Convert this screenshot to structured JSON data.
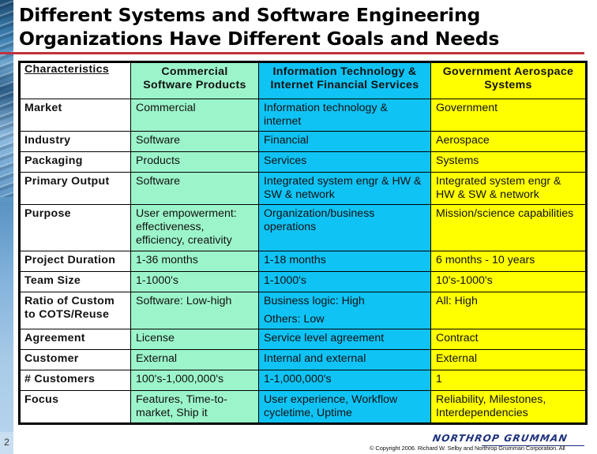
{
  "slide": {
    "title_line1": "Different Systems and Software Engineering",
    "title_line2": "Organizations Have Different Goals and Needs",
    "page_number": "2",
    "logo_text": "NORTHROP GRUMMAN",
    "copyright": "© Copyright 2006. Richard W. Selby and Northrop Grumman Corporation. All"
  },
  "colors": {
    "commercial": "#9cf5ca",
    "it_financial": "#10c3f5",
    "government": "#ffff00",
    "title_rule": "#c0303c"
  },
  "table": {
    "headers": [
      "Characteristics",
      "Commercial Software Products",
      "Information Technology & Internet Financial Services",
      "Government Aerospace Systems"
    ],
    "header_lines": {
      "commercial": [
        "Commercial",
        "Software Products"
      ],
      "it": [
        "Information Technology &",
        "Internet Financial Services"
      ],
      "gov": [
        "Government Aerospace",
        "Systems"
      ]
    },
    "rows": [
      {
        "label": "Market",
        "commercial": "Commercial",
        "it": "Information technology & internet",
        "gov": "Government"
      },
      {
        "label": "Industry",
        "commercial": "Software",
        "it": "Financial",
        "gov": "Aerospace"
      },
      {
        "label": "Packaging",
        "commercial": "Products",
        "it": "Services",
        "gov": "Systems"
      },
      {
        "label": "Primary Output",
        "commercial": "Software",
        "it": "Integrated system engr & HW & SW & network",
        "gov": "Integrated system engr & HW & SW & network"
      },
      {
        "label": "Purpose",
        "commercial": "User empowerment: effectiveness, efficiency, creativity",
        "it": "Organization/business operations",
        "gov": "Mission/science capabilities"
      },
      {
        "label": "Project Duration",
        "commercial": "1-36 months",
        "it": "1-18 months",
        "gov": "6 months - 10 years"
      },
      {
        "label": "Team Size",
        "commercial": "1-1000's",
        "it": "1-1000's",
        "gov": "10's-1000's"
      },
      {
        "label": "Ratio of Custom to COTS/Reuse",
        "commercial": "Software: Low-high",
        "it": "Business logic: High",
        "it_line2": "Others: Low",
        "gov": "All: High"
      },
      {
        "label": "Agreement",
        "commercial": "License",
        "it": "Service level agreement",
        "gov": "Contract"
      },
      {
        "label": "Customer",
        "commercial": "External",
        "it": "Internal and external",
        "gov": "External"
      },
      {
        "label": "# Customers",
        "commercial": "100's-1,000,000's",
        "it": "1-1,000,000's",
        "gov": "1"
      },
      {
        "label": "Focus",
        "commercial": "Features, Time-to-market, Ship it",
        "it": "User experience, Workflow cycletime, Uptime",
        "gov": "Reliability, Milestones, Interdependencies"
      }
    ]
  }
}
